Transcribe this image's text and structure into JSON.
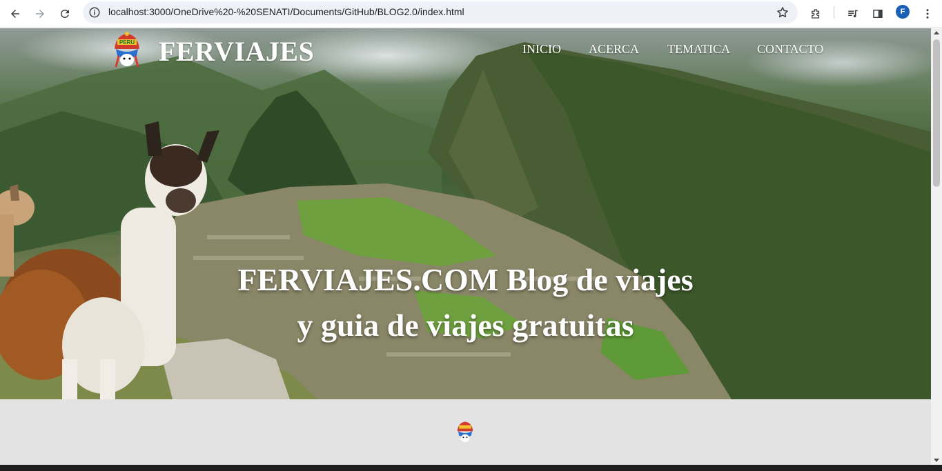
{
  "browser": {
    "url": "localhost:3000/OneDrive%20-%20SENATI/Documents/GitHub/BLOG2.0/index.html",
    "profile_initial": "F",
    "icons": [
      "back-icon",
      "forward-icon",
      "reload-icon",
      "site-info-icon",
      "bookmark-star-icon",
      "extensions-icon",
      "media-control-icon",
      "side-panel-icon",
      "more-menu-icon"
    ]
  },
  "site": {
    "brand": "FERVIAJES",
    "nav": [
      "INICIO",
      "ACERCA",
      "TEMATICA",
      "CONTACTO"
    ],
    "hero": {
      "line1": "FERVIAJES.COM Blog de viajes",
      "line2": "y guia de viajes gratuitas"
    },
    "logo_text": "PERU"
  },
  "colors": {
    "avatar": "#1a5fb4",
    "section_bg": "#e3e3e3",
    "omnibox_bg": "#eef1f8"
  }
}
